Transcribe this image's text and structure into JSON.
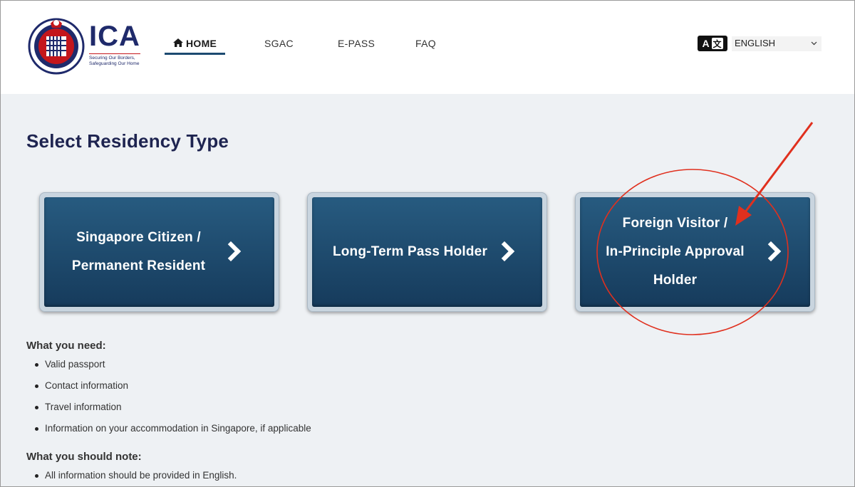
{
  "logo": {
    "name": "ICA",
    "tagline1": "Securing Our Borders,",
    "tagline2": "Safeguarding Our Home"
  },
  "nav": {
    "items": [
      {
        "label": "HOME",
        "icon": "home-icon",
        "active": true
      },
      {
        "label": "SGAC"
      },
      {
        "label": "E-PASS"
      },
      {
        "label": "FAQ"
      }
    ]
  },
  "language": {
    "icon": "translate-az-icon",
    "icon_a": "A",
    "icon_z": "文",
    "selected": "ENGLISH"
  },
  "main": {
    "title": "Select Residency Type",
    "cards": [
      {
        "label": "Singapore Citizen /\nPermanent Resident"
      },
      {
        "label": "Long-Term Pass Holder"
      },
      {
        "label": "Foreign Visitor /\nIn-Principle Approval\nHolder"
      }
    ],
    "needs_heading": "What you need:",
    "needs": [
      "Valid passport",
      "Contact information",
      "Travel information",
      "Information on your accommodation in Singapore, if applicable"
    ],
    "note_heading": "What you should note:",
    "notes": [
      "All information should be provided in English."
    ]
  },
  "colors": {
    "brand_navy": "#1f2a6b",
    "card_blue": "#1f4d72",
    "annotation_red": "#e0301e"
  }
}
